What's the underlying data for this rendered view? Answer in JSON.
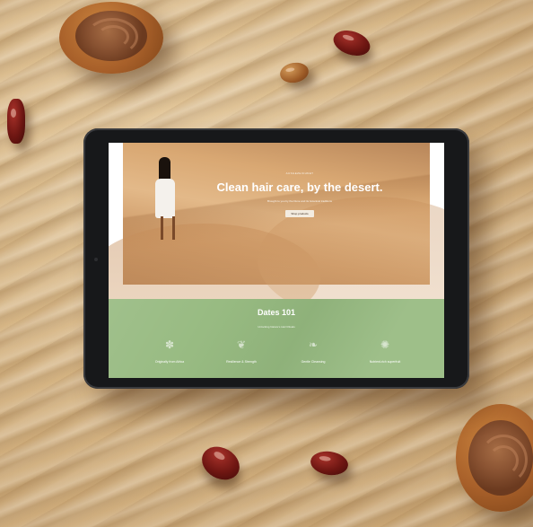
{
  "hero": {
    "eyebrow": "AUSGEZEICHNET",
    "title": "Clean hair care, by the desert.",
    "subtitle": "Brought to you by the Dune and its botanical traditions",
    "button": "Shop products"
  },
  "dates101": {
    "title": "Dates 101",
    "subtitle": "Unlocking Nature's Hair Rituals",
    "features": [
      {
        "icon": "palm-tree-icon",
        "glyph": "✽",
        "label": "Originally from Africa"
      },
      {
        "icon": "leaf-icon",
        "glyph": "❦",
        "label": "Resilience & Strength"
      },
      {
        "icon": "drop-icon",
        "glyph": "❧",
        "label": "Gentle Cleansing"
      },
      {
        "icon": "sprout-icon",
        "glyph": "✺",
        "label": "Nutrient-rich superfruit"
      }
    ]
  }
}
